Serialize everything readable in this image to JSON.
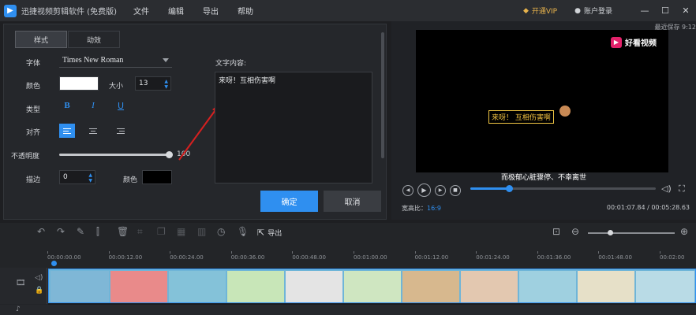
{
  "app": {
    "title": "迅捷视频剪辑软件 (免费版)",
    "menu": [
      "文件",
      "编辑",
      "导出",
      "帮助"
    ],
    "vip": "开通VIP",
    "login": "账户登录"
  },
  "panel": {
    "tabs": [
      "样式",
      "动效"
    ],
    "font_label": "字体",
    "font_value": "Times New Roman",
    "color_label": "颜色",
    "size_label": "大小",
    "size_value": "13",
    "type_label": "类型",
    "bold": "B",
    "italic": "I",
    "underline": "U",
    "align_label": "对齐",
    "opacity_label": "不透明度",
    "opacity_value": "100",
    "stroke_label": "描边",
    "stroke_value": "0",
    "stroke_color_label": "颜色",
    "text_label": "文字内容:",
    "text_value": "来呀！互相伤害啊",
    "ok": "确定",
    "cancel": "取消",
    "colors": {
      "text": "#ffffff",
      "stroke": "#000000"
    }
  },
  "preview": {
    "autosave": "最近保存 9:12",
    "watermark": "好看视频",
    "overlay": "来呀！ 互相伤害啊",
    "subtitle": "而极郁心脏骤停、不幸离世",
    "ratio_label": "宽高比：",
    "ratio_value": "16:9",
    "time": "00:01:07.84 / 00:05:28.63",
    "progress": 0.21
  },
  "timeline": {
    "export": "导出",
    "ticks": [
      "00:00:00.00",
      "00:00:12.00",
      "00:00:24.00",
      "00:00:36.00",
      "00:00:48.00",
      "00:01:00.00",
      "00:01:12.00",
      "00:01:24.00",
      "00:01:36.00",
      "00:01:48.00",
      "00:02:00"
    ]
  },
  "accent": "#2f8ff0"
}
